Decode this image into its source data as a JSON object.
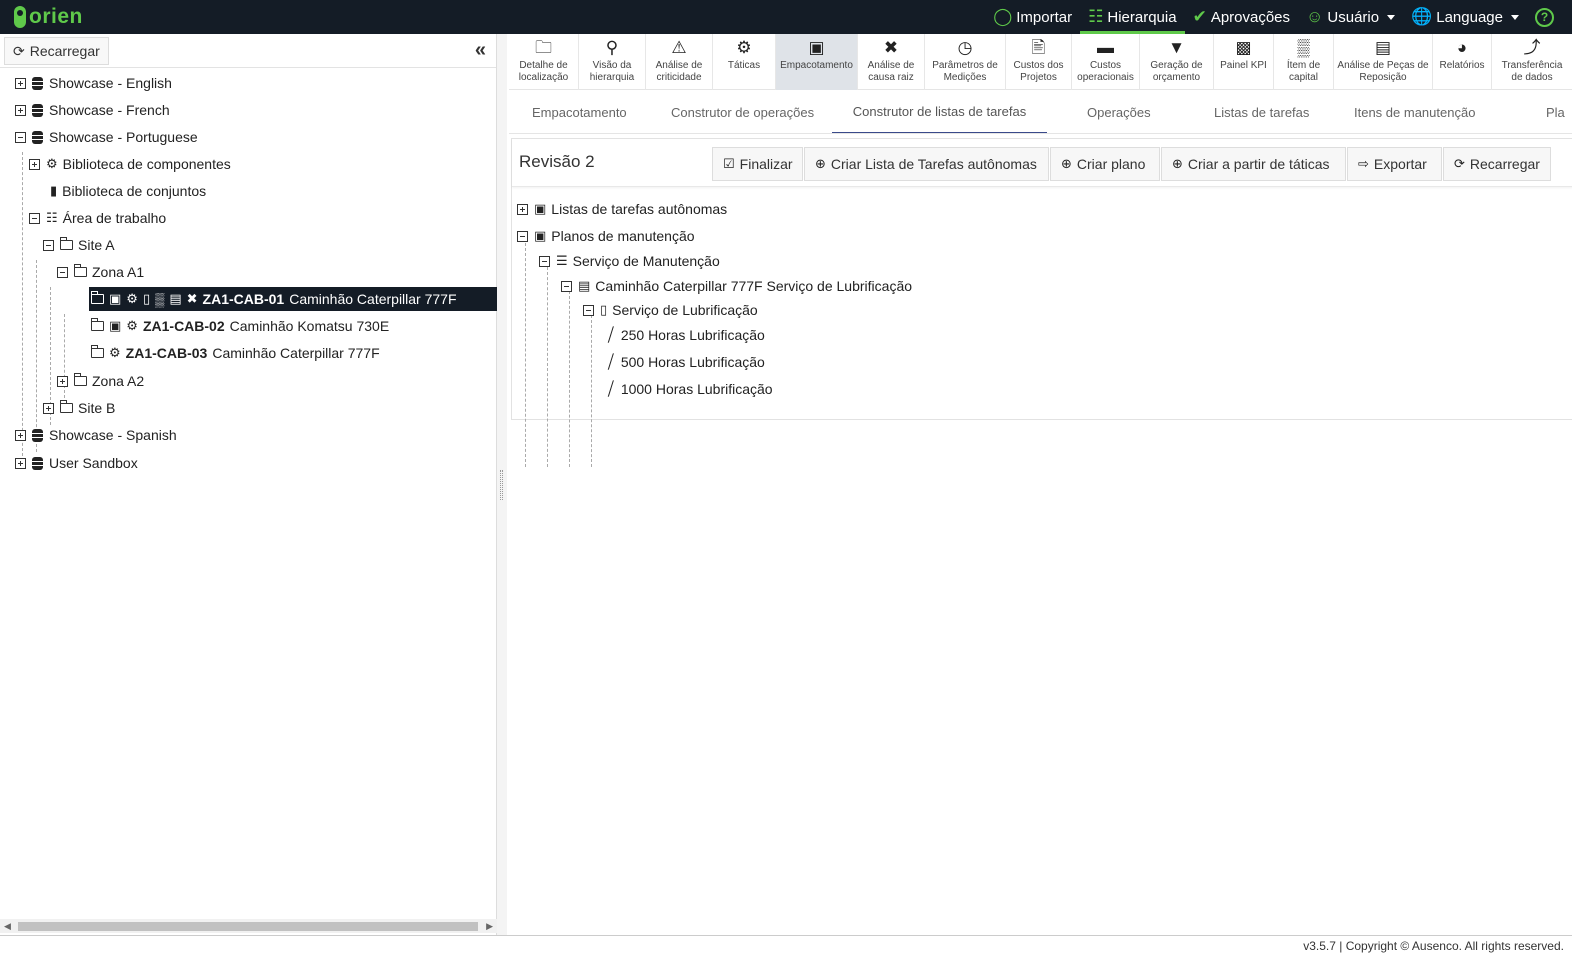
{
  "app": {
    "logo_text": "orien",
    "brand_color": "#5fc94a",
    "topbar_bg": "#141c26"
  },
  "topnav": [
    {
      "label": "Importar",
      "icon": "lightbulb-icon"
    },
    {
      "label": "Hierarquia",
      "icon": "sitemap-icon",
      "active": true
    },
    {
      "label": "Aprovações",
      "icon": "check-circle-icon"
    },
    {
      "label": "Usuário",
      "icon": "user-icon"
    },
    {
      "label": "Language",
      "icon": "globe-icon"
    }
  ],
  "left": {
    "reload_label": "Recarregar",
    "tree": {
      "showcase_english": "Showcase - English",
      "showcase_french": "Showcase - French",
      "showcase_portuguese": "Showcase - Portuguese",
      "biblioteca_componentes": "Biblioteca de componentes",
      "biblioteca_conjuntos": "Biblioteca de conjuntos",
      "area_trabalho": "Área de trabalho",
      "site_a": "Site A",
      "zona_a1": "Zona A1",
      "asset1_code": "ZA1-CAB-01",
      "asset1_name": "Caminhão Caterpillar 777F",
      "asset2_code": "ZA1-CAB-02",
      "asset2_name": "Caminhão Komatsu 730E",
      "asset3_code": "ZA1-CAB-03",
      "asset3_name": "Caminhão Caterpillar 777F",
      "zona_a2": "Zona A2",
      "site_b": "Site B",
      "showcase_spanish": "Showcase - Spanish",
      "user_sandbox": "User Sandbox"
    }
  },
  "modules": [
    {
      "label1": "Detalhe de",
      "label2": "localização",
      "icon": "folder-icon"
    },
    {
      "label1": "Visão da",
      "label2": "hierarquia",
      "icon": "search-icon"
    },
    {
      "label1": "Análise de",
      "label2": "criticidade",
      "icon": "warning-icon"
    },
    {
      "label1": "Táticas",
      "label2": "",
      "icon": "gear-icon"
    },
    {
      "label1": "Empacotamento",
      "label2": "",
      "icon": "package-icon",
      "active": true
    },
    {
      "label1": "Análise de",
      "label2": "causa raiz",
      "icon": "tools-icon"
    },
    {
      "label1": "Parâmetros de",
      "label2": "Medições",
      "icon": "gauge-icon"
    },
    {
      "label1": "Custos dos",
      "label2": "Projetos",
      "icon": "invoice-icon"
    },
    {
      "label1": "Custos",
      "label2": "operacionais",
      "icon": "credit-card-icon"
    },
    {
      "label1": "Geração de",
      "label2": "orçamento",
      "icon": "funnel-dollar-icon"
    },
    {
      "label1": "Painel KPI",
      "label2": "",
      "icon": "bar-chart-icon"
    },
    {
      "label1": "Ítem de",
      "label2": "capital",
      "icon": "industry-icon"
    },
    {
      "label1": "Análise de Peças de",
      "label2": "Reposição",
      "icon": "dolly-icon"
    },
    {
      "label1": "Relatórios",
      "label2": "",
      "icon": "pie-chart-icon"
    },
    {
      "label1": "Transferência",
      "label2": "de dados",
      "icon": "share-icon"
    }
  ],
  "subtabs": [
    "Empacotamento",
    "Construtor de operações",
    "Construtor de listas de tarefas",
    "Operações",
    "Listas de tarefas",
    "Itens de manutenção",
    "Pla"
  ],
  "card": {
    "title": "Revisão 2",
    "buttons": {
      "finalizar": "Finalizar",
      "criar_lista": "Criar Lista de Tarefas autônomas",
      "criar_plano": "Criar plano",
      "criar_taticas": "Criar a partir de táticas",
      "exportar": "Exportar",
      "recarregar": "Recarregar"
    },
    "tree": {
      "listas_autonomas": "Listas de tarefas autônomas",
      "planos_manutencao": "Planos de manutenção",
      "servico_manutencao": "Serviço de Manutenção",
      "caminhao_servico": "Caminhão Caterpillar 777F Serviço de Lubrificação",
      "servico_lubrificacao": "Serviço de Lubrificação",
      "task_250": "250 Horas Lubrificação",
      "task_500": "500 Horas Lubrificação",
      "task_1000": "1000 Horas Lubrificação"
    }
  },
  "footer": {
    "text": "v3.5.7 | Copyright © Ausenco. All rights reserved."
  }
}
